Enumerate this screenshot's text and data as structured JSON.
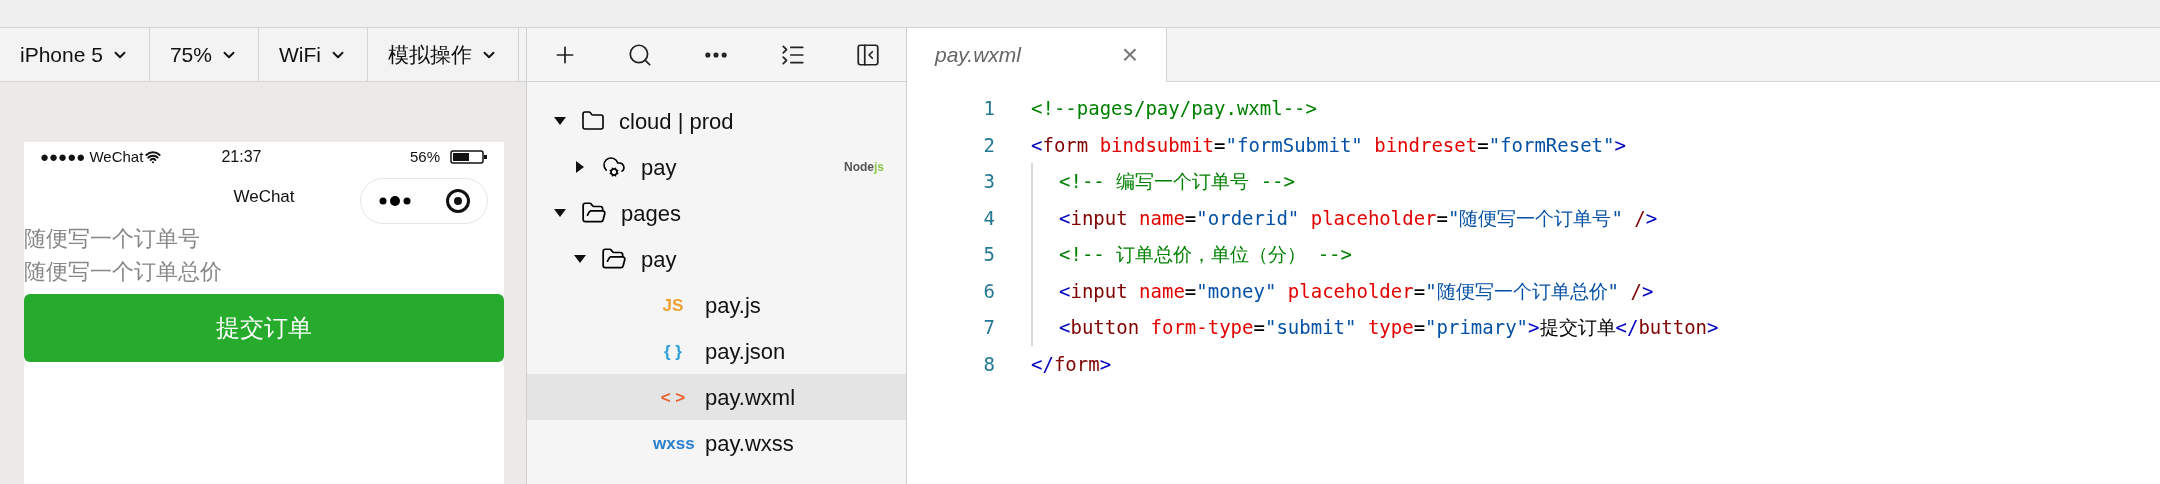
{
  "simulator_toolbar": [
    {
      "label": "iPhone 5"
    },
    {
      "label": "75%"
    },
    {
      "label": "WiFi"
    },
    {
      "label": "模拟操作"
    }
  ],
  "phone": {
    "carrier": "●●●●● WeChat",
    "time": "21:37",
    "battery": "56%",
    "title": "WeChat",
    "inputs": [
      {
        "placeholder": "随便写一个订单号"
      },
      {
        "placeholder": "随便写一个订单总价"
      }
    ],
    "button": "提交订单"
  },
  "explorer": {
    "tree": [
      {
        "kind": "cloud-folder",
        "label": "cloud | prod",
        "expanded": true,
        "selected": false,
        "children": [
          {
            "kind": "cloud-function",
            "label": "pay",
            "expanded": false,
            "selected": false,
            "badge": [
              "Node",
              "js"
            ]
          }
        ]
      },
      {
        "kind": "folder",
        "label": "pages",
        "expanded": true,
        "selected": false,
        "children": [
          {
            "kind": "folder",
            "label": "pay",
            "expanded": true,
            "selected": false,
            "children": [
              {
                "kind": "file",
                "glyph": "JS",
                "color": "#f0a030",
                "label": "pay.js",
                "selected": false
              },
              {
                "kind": "file",
                "glyph": "{ }",
                "color": "#2a9fd8",
                "label": "pay.json",
                "selected": false
              },
              {
                "kind": "file",
                "glyph": "< >",
                "color": "#e8602c",
                "label": "pay.wxml",
                "selected": true
              },
              {
                "kind": "file",
                "glyph": "wxss",
                "color": "#2a7fd0",
                "label": "pay.wxss",
                "selected": false
              }
            ]
          }
        ]
      }
    ]
  },
  "editor": {
    "tabs": [
      {
        "label": "pay.wxml",
        "selected": true,
        "close": "×"
      }
    ],
    "lines": [
      {
        "number": "1",
        "indented": false,
        "tokens": [
          {
            "kind": "comment",
            "text": "<!--pages/pay/pay.wxml-->"
          }
        ]
      },
      {
        "number": "2",
        "indented": false,
        "tokens": [
          {
            "kind": "punct",
            "text": "<"
          },
          {
            "kind": "tag",
            "text": "form"
          },
          {
            "kind": "attr",
            "text": " bindsubmit"
          },
          {
            "kind": "text",
            "text": "="
          },
          {
            "kind": "string",
            "text": "\"formSubmit\""
          },
          {
            "kind": "attr",
            "text": " bindreset"
          },
          {
            "kind": "text",
            "text": "="
          },
          {
            "kind": "string",
            "text": "\"formReset\""
          },
          {
            "kind": "punct",
            "text": ">"
          }
        ]
      },
      {
        "number": "3",
        "indented": true,
        "tokens": [
          {
            "kind": "comment",
            "text": "<!-- 编写一个订单号 -->"
          }
        ]
      },
      {
        "number": "4",
        "indented": true,
        "tokens": [
          {
            "kind": "punct",
            "text": "<"
          },
          {
            "kind": "tag",
            "text": "input"
          },
          {
            "kind": "attr",
            "text": " name"
          },
          {
            "kind": "text",
            "text": "="
          },
          {
            "kind": "string",
            "text": "\"orderid\""
          },
          {
            "kind": "attr",
            "text": " placeholder"
          },
          {
            "kind": "text",
            "text": "="
          },
          {
            "kind": "string",
            "text": "\"随便写一个订单号\""
          },
          {
            "kind": "tag",
            "text": " /"
          },
          {
            "kind": "punct",
            "text": ">"
          }
        ]
      },
      {
        "number": "5",
        "indented": true,
        "tokens": [
          {
            "kind": "comment",
            "text": "<!-- 订单总价，单位（分） -->"
          }
        ]
      },
      {
        "number": "6",
        "indented": true,
        "tokens": [
          {
            "kind": "punct",
            "text": "<"
          },
          {
            "kind": "tag",
            "text": "input"
          },
          {
            "kind": "attr",
            "text": " name"
          },
          {
            "kind": "text",
            "text": "="
          },
          {
            "kind": "string",
            "text": "\"money\""
          },
          {
            "kind": "attr",
            "text": " placeholder"
          },
          {
            "kind": "text",
            "text": "="
          },
          {
            "kind": "string",
            "text": "\"随便写一个订单总价\""
          },
          {
            "kind": "tag",
            "text": " /"
          },
          {
            "kind": "punct",
            "text": ">"
          }
        ]
      },
      {
        "number": "7",
        "indented": true,
        "tokens": [
          {
            "kind": "punct",
            "text": "<"
          },
          {
            "kind": "tag",
            "text": "button"
          },
          {
            "kind": "attr",
            "text": " form-type"
          },
          {
            "kind": "text",
            "text": "="
          },
          {
            "kind": "string",
            "text": "\"submit\""
          },
          {
            "kind": "attr",
            "text": " type"
          },
          {
            "kind": "text",
            "text": "="
          },
          {
            "kind": "string",
            "text": "\"primary\""
          },
          {
            "kind": "punct",
            "text": ">"
          },
          {
            "kind": "text",
            "text": "提交订单"
          },
          {
            "kind": "punct",
            "text": "</"
          },
          {
            "kind": "tag",
            "text": "button"
          },
          {
            "kind": "punct",
            "text": ">"
          }
        ]
      },
      {
        "number": "8",
        "indented": false,
        "tokens": [
          {
            "kind": "punct",
            "text": "</"
          },
          {
            "kind": "tag",
            "text": "form"
          },
          {
            "kind": "punct",
            "text": ">"
          }
        ]
      }
    ]
  }
}
